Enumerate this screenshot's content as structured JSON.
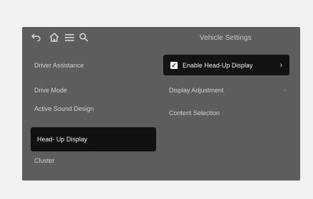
{
  "screen": {
    "title": "Vehicle Settings"
  },
  "toolbar": {
    "icons": [
      "back-icon",
      "home-icon",
      "menu-icon",
      "search-icon"
    ]
  },
  "left_menu": {
    "items": [
      {
        "label": "Driver Assistance"
      },
      {
        "label": "Drive Mode"
      },
      {
        "label": "Active Sound Design"
      },
      {
        "label": "Head- Up Display",
        "selected": true
      },
      {
        "label": "Cluster"
      }
    ]
  },
  "right_panel": {
    "rows": [
      {
        "label": "Enable Head-Up Display",
        "checked": true,
        "chevron": "›"
      },
      {
        "label": "Display Adjustment",
        "chevron": "›"
      },
      {
        "label": "Content Selection"
      }
    ]
  },
  "colors": {
    "background": "#5d5d5d",
    "selected_bg": "#111111",
    "text": "#d0d0d0"
  }
}
